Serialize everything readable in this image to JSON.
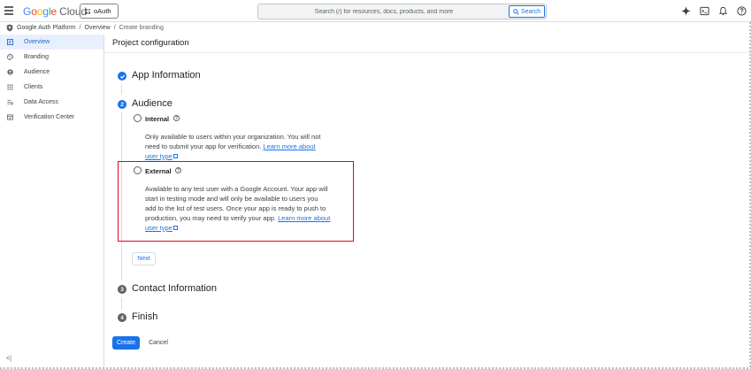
{
  "header": {
    "logo_google": "Google",
    "logo_cloud": "Cloud",
    "project": "oAuth",
    "search_placeholder": "Search (/) for resources, docs, products, and more",
    "search_button": "Search"
  },
  "breadcrumb": {
    "items": [
      "Google Auth Platform",
      "Overview",
      "Create branding"
    ],
    "separator": "/"
  },
  "sidebar": {
    "items": [
      {
        "label": "Overview",
        "icon": "overview-icon",
        "active": true
      },
      {
        "label": "Branding",
        "icon": "palette-icon"
      },
      {
        "label": "Audience",
        "icon": "person-icon"
      },
      {
        "label": "Clients",
        "icon": "grid-icon"
      },
      {
        "label": "Data Access",
        "icon": "data-access-icon"
      },
      {
        "label": "Verification Center",
        "icon": "verification-icon"
      }
    ],
    "collapse": "<|"
  },
  "main": {
    "title": "Project configuration",
    "steps": [
      {
        "number": "",
        "title": "App Information",
        "state": "done"
      },
      {
        "number": "2",
        "title": "Audience",
        "state": "active"
      },
      {
        "number": "3",
        "title": "Contact Information",
        "state": "pending"
      },
      {
        "number": "4",
        "title": "Finish",
        "state": "pending"
      }
    ],
    "options": {
      "internal": {
        "label": "Internal",
        "desc_line1": "Only available to users within your organization. You will not",
        "desc_line2_text": "need to submit your app for verification.",
        "link_part1": "Learn more about",
        "link_part2": "user type"
      },
      "external": {
        "label": "External",
        "desc_line1": "Available to any test user with a Google Account. Your app will",
        "desc_line2": "start in testing mode and will only be available to users you",
        "desc_line3": "add to the list of test users. Once your app is ready to push to",
        "desc_line4_text": "production, you may need to verify your app.",
        "link_part1": "Learn more about",
        "link_part2": "user type"
      }
    },
    "help_glyph": "?",
    "next_button": "Next",
    "create_button": "Create",
    "cancel_button": "Cancel"
  },
  "colors": {
    "accent": "#1a73e8",
    "highlight": "#e8001c"
  }
}
